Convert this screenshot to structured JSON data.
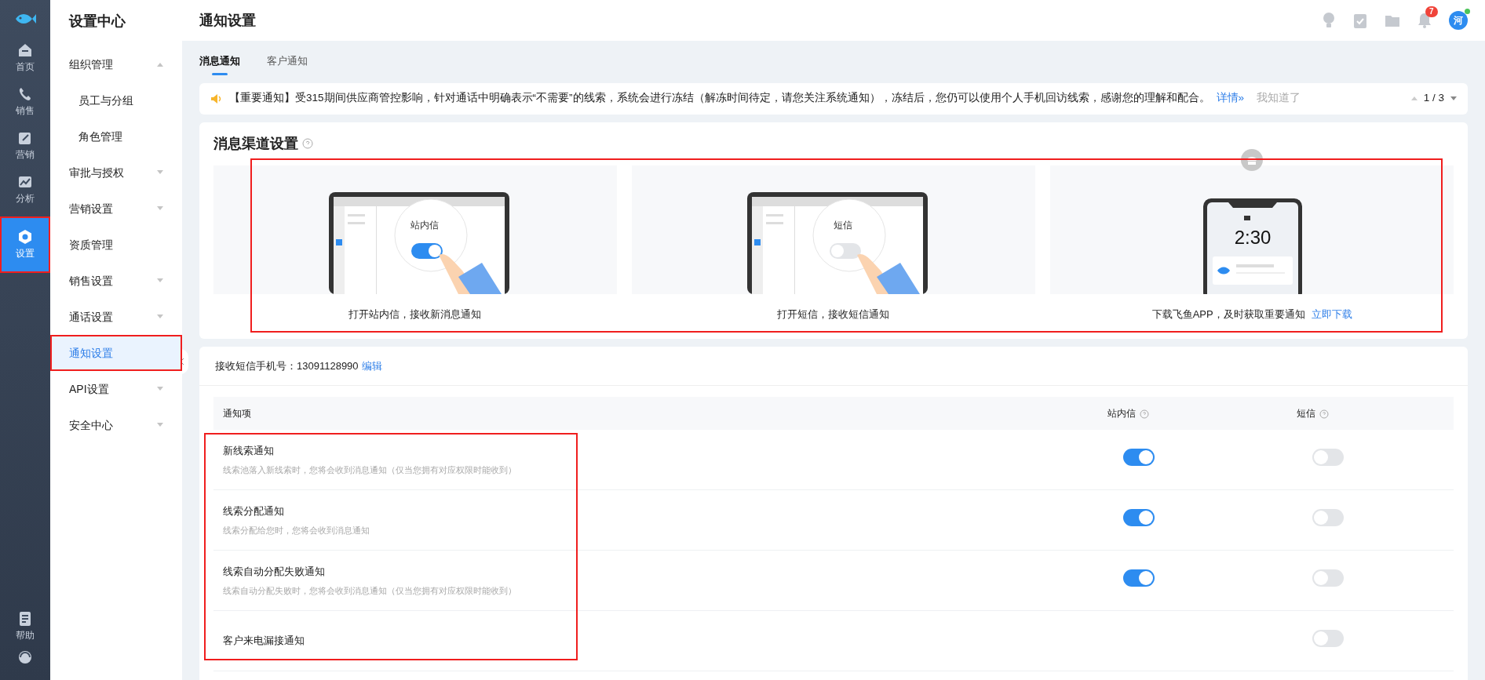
{
  "rail": {
    "items": [
      {
        "label": "首页",
        "kind": "home",
        "selected": false,
        "highlighted": false
      },
      {
        "label": "销售",
        "kind": "phone",
        "selected": false,
        "highlighted": false
      },
      {
        "label": "营销",
        "kind": "edit",
        "selected": false,
        "highlighted": false
      },
      {
        "label": "分析",
        "kind": "chart",
        "selected": false,
        "highlighted": false
      },
      {
        "label": "设置",
        "kind": "gear",
        "selected": true,
        "highlighted": true
      }
    ],
    "bottom_items": [
      {
        "label": "帮助",
        "kind": "doc"
      },
      {
        "kind": "headset"
      }
    ]
  },
  "menu": {
    "title": "设置中心",
    "items": [
      {
        "label": "组织管理",
        "expanded": true,
        "children": [
          {
            "label": "员工与分组",
            "selected": false,
            "highlighted": false
          },
          {
            "label": "角色管理",
            "selected": false,
            "highlighted": false
          }
        ],
        "selected": false,
        "highlighted": false
      },
      {
        "label": "审批与授权",
        "expanded": false,
        "selected": false,
        "highlighted": false
      },
      {
        "label": "营销设置",
        "expanded": false,
        "selected": false,
        "highlighted": false
      },
      {
        "label": "资质管理",
        "selected": false,
        "highlighted": false
      },
      {
        "label": "销售设置",
        "expanded": false,
        "selected": false,
        "highlighted": false
      },
      {
        "label": "通话设置",
        "expanded": false,
        "selected": false,
        "highlighted": false
      },
      {
        "label": "通知设置",
        "selected": true,
        "highlighted": true
      },
      {
        "label": "API设置",
        "expanded": false,
        "selected": false,
        "highlighted": false
      },
      {
        "label": "安全中心",
        "expanded": false,
        "selected": false,
        "highlighted": false
      }
    ]
  },
  "header": {
    "title": "通知设置",
    "notification_count": "7",
    "avatar": "河"
  },
  "tabs": [
    {
      "label": "消息通知",
      "selected": true
    },
    {
      "label": "客户通知",
      "selected": false
    }
  ],
  "notice": {
    "text": "【重要通知】受315期间供应商管控影响，针对通话中明确表示“不需要”的线索，系统会进行冻结（解冻时间待定，请您关注系统通知），冻结后，您仍可以使用个人手机回访线索，感谢您的理解和配合。",
    "link": "详情»",
    "dismiss": "我知道了",
    "pager": "1 / 3"
  },
  "channels": {
    "title": "消息渠道设置",
    "highlighted": true,
    "items": [
      {
        "kind": "laptop",
        "screen_label": "站内信",
        "on": true,
        "caption": "打开站内信，接收新消息通知"
      },
      {
        "kind": "laptop",
        "screen_label": "短信",
        "on": false,
        "caption": "打开短信，接收短信通知"
      },
      {
        "kind": "phone",
        "screen_label": "2:30",
        "caption": "下载飞鱼APP，及时获取重要通知",
        "link": "立即下载"
      }
    ]
  },
  "sms_phone": {
    "label": "接收短信手机号：13091128990",
    "link": "编辑"
  },
  "table": {
    "columns": [
      "通知项",
      "站内信",
      "短信"
    ],
    "highlighted": true,
    "rows": [
      {
        "title": "新线索通知",
        "description": "线索池落入新线索时，您将会收到消息通知（仅当您拥有对应权限时能收到）",
        "inbox": true,
        "sms": false
      },
      {
        "title": "线索分配通知",
        "description": "线索分配给您时，您将会收到消息通知",
        "inbox": true,
        "sms": false
      },
      {
        "title": "线索自动分配失败通知",
        "description": "线索自动分配失败时，您将会收到消息通知（仅当您拥有对应权限时能收到）",
        "inbox": true,
        "sms": false
      },
      {
        "title": "客户来电漏接通知",
        "sms": false
      }
    ]
  }
}
